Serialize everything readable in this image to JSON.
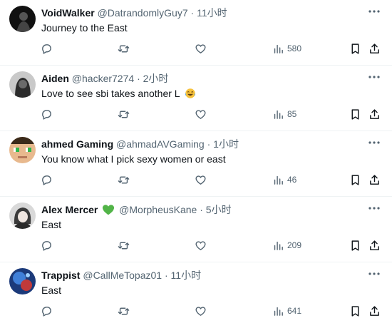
{
  "tweets": [
    {
      "name": "VoidWalker",
      "handle": "@DatrandomlyGuy7",
      "separator": "·",
      "time": "11小时",
      "text": "Journey to the East",
      "views": "580",
      "avatar_icon": "avatar-dark-figure"
    },
    {
      "name": "Aiden",
      "handle": "@hacker7274",
      "separator": "·",
      "time": "2小时",
      "text": "Love to see sbi takes another L",
      "emoji": "face-with-tears-of-joy",
      "views": "85",
      "avatar_icon": "avatar-gray-hooded-figure"
    },
    {
      "name": "ahmed Gaming",
      "handle": "@ahmadAVGaming",
      "separator": "·",
      "time": "1小时",
      "text": "You know what I pick sexy women or east",
      "views": "46",
      "avatar_icon": "avatar-pixel-face"
    },
    {
      "name": "Alex Mercer",
      "handle": "@MorpheusKane",
      "separator": "·",
      "time": "5小时",
      "text": "East",
      "views": "209",
      "badge_icon": "green-heart-icon",
      "avatar_icon": "avatar-anime-gray"
    },
    {
      "name": "Trappist",
      "handle": "@CallMeTopaz01",
      "separator": "·",
      "time": "11小时",
      "text": "East",
      "views": "641",
      "avatar_icon": "avatar-blue-space"
    }
  ],
  "icons": {
    "reply": "reply-icon",
    "retweet": "retweet-icon",
    "like": "like-icon",
    "views": "views-icon",
    "bookmark": "bookmark-icon",
    "share": "share-icon",
    "more": "more-icon"
  },
  "colors": {
    "text": "#0f1419",
    "secondary": "#536471",
    "divider": "#eff3f4",
    "heart_badge": "#52b448"
  }
}
